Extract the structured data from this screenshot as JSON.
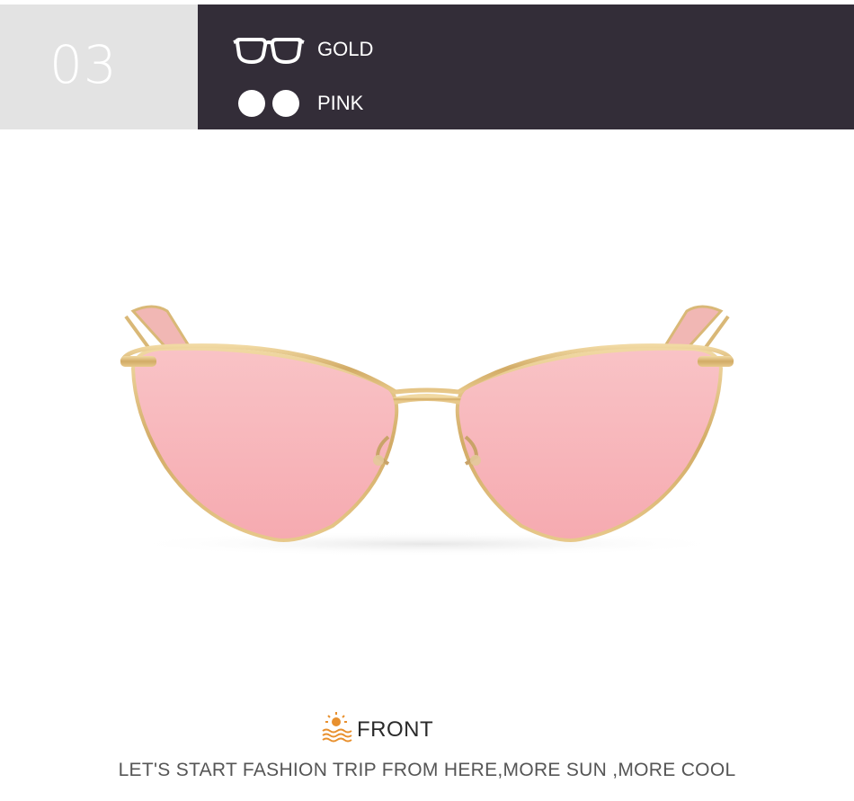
{
  "header": {
    "number": "03",
    "frame": {
      "icon": "glasses-outline-icon",
      "label": "GOLD"
    },
    "lens": {
      "icon": "lens-dots-icon",
      "label": "PINK"
    }
  },
  "product": {
    "image": "cat-eye-sunglasses-photo",
    "frame_color": "#d9b877",
    "lens_color": "#f7b6bd"
  },
  "caption": {
    "icon": "sun-over-waves-icon",
    "title": "FRONT",
    "subtitle": "LET'S START FASHION TRIP FROM HERE,MORE SUN ,MORE COOL"
  },
  "colors": {
    "header_dark": "#332d38",
    "header_light": "#e3e3e3",
    "accent_orange": "#e8902e"
  }
}
